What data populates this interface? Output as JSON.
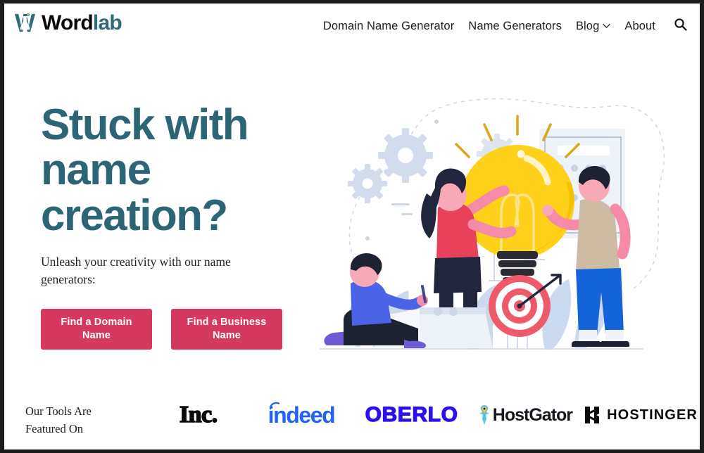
{
  "brand": {
    "icon": "flask-logo-icon",
    "name_part1": "Word",
    "name_part2": "lab"
  },
  "nav": {
    "items": [
      {
        "label": "Domain Name Generator",
        "has_dropdown": false
      },
      {
        "label": "Name Generators",
        "has_dropdown": false
      },
      {
        "label": "Blog",
        "has_dropdown": true
      },
      {
        "label": "About",
        "has_dropdown": false
      }
    ],
    "search_icon": "search-icon",
    "chevron_icon": "chevron-down-icon"
  },
  "hero": {
    "title": "Stuck with name creation?",
    "subtitle": "Unleash your creativity with our name generators:",
    "buttons": [
      {
        "label": "Find a Domain Name"
      },
      {
        "label": "Find a Business Name"
      }
    ],
    "illustration": "lightbulb-teamwork-illustration"
  },
  "featured": {
    "label": "Our Tools Are Featured On",
    "logos": [
      {
        "name": "inc-logo",
        "text": "Inc."
      },
      {
        "name": "indeed-logo",
        "text": "indeed"
      },
      {
        "name": "oberlo-logo",
        "text": "OBERLO"
      },
      {
        "name": "hostgator-logo",
        "text": "HostGator"
      },
      {
        "name": "hostinger-logo",
        "text": "HOSTINGER"
      }
    ]
  },
  "colors": {
    "teal": "#2c6675",
    "crimson": "#d6395e",
    "bulb_yellow": "#FFD11A",
    "indeed_blue": "#2164f3",
    "oberlo_purple": "#2b10ef",
    "page_border": "#1b1b1b"
  }
}
